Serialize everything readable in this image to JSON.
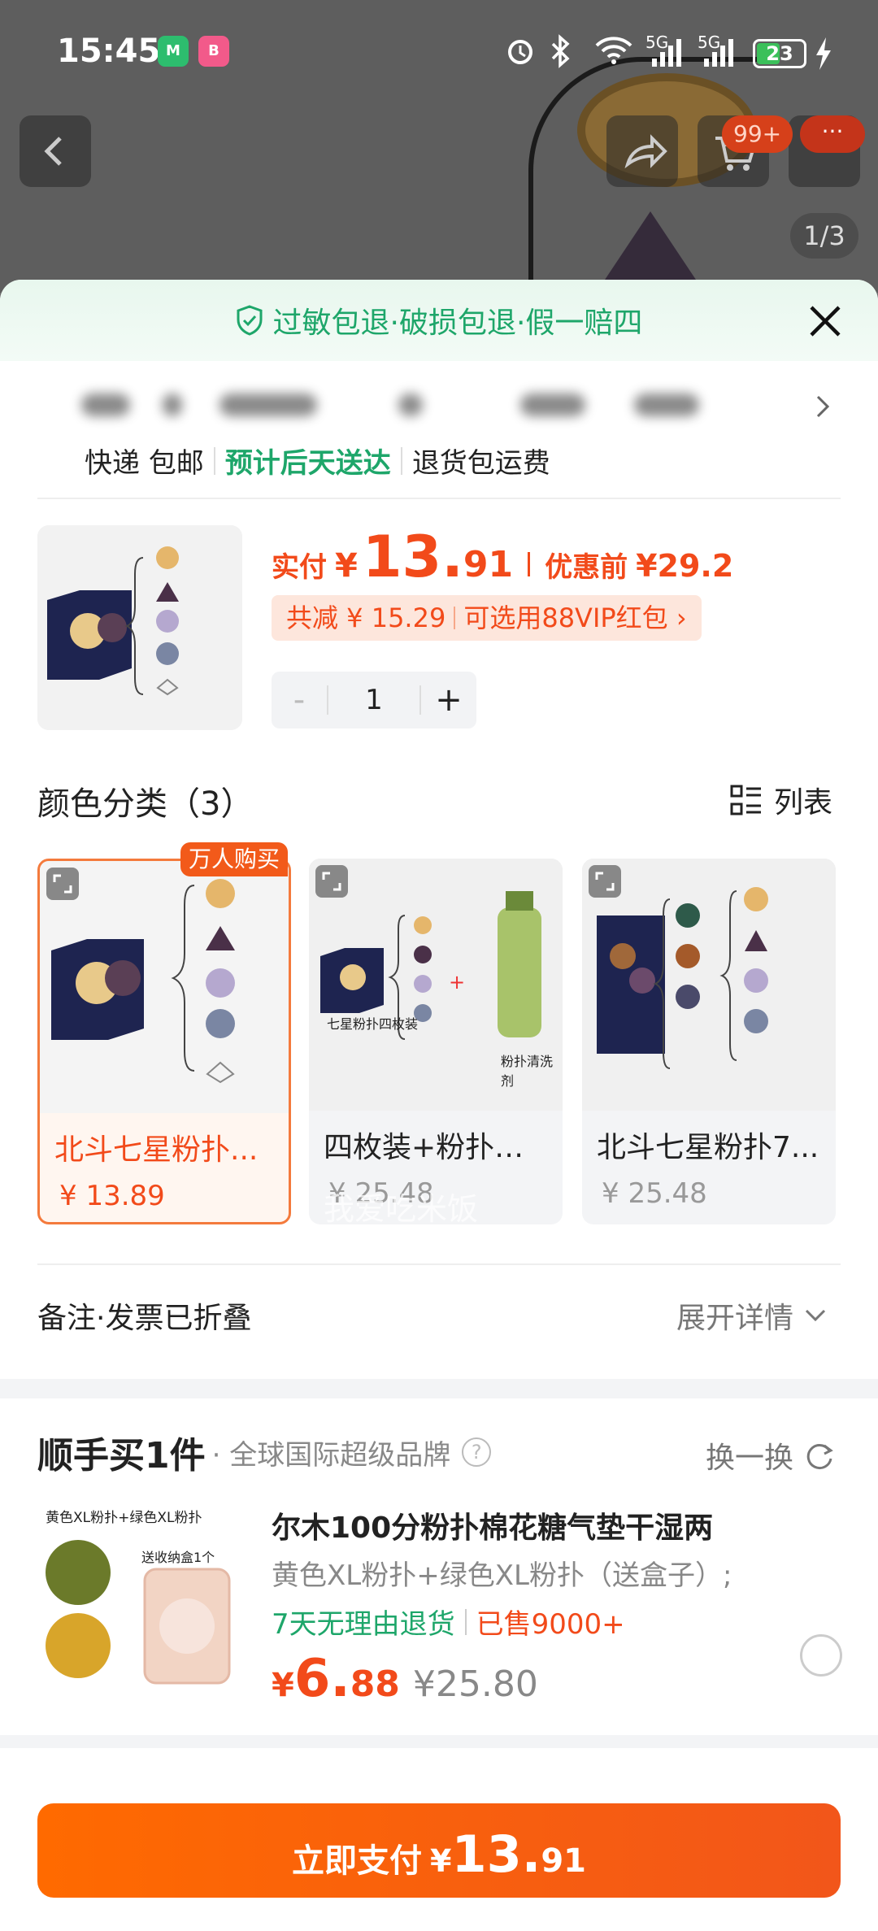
{
  "status_bar": {
    "time": "15:45",
    "battery": "23",
    "signal1": "5G",
    "signal2": "5G"
  },
  "background": {
    "cart_badge": "99+",
    "more_badge": "···",
    "image_pager": "1/3"
  },
  "sheet": {
    "guarantee": "过敏包退·破损包退·假一赔四",
    "shipping": {
      "method": "快递 包邮",
      "eta": "预计后天送达",
      "returns": "退货包运费"
    },
    "price": {
      "paid_label": "实付",
      "currency": "¥",
      "paid_int": "13.",
      "paid_dec": "91",
      "before_label": "优惠前",
      "before_value": "¥29.2"
    },
    "discount": {
      "saved": "共减 ¥ 15.29",
      "vip": "可选用88VIP红包 ›"
    },
    "quantity": {
      "minus": "-",
      "value": "1",
      "plus": "+"
    },
    "variants": {
      "title": "颜色分类（3）",
      "list_view_label": "列表",
      "hot_tag": "万人购买",
      "items": [
        {
          "name": "北斗七星粉扑...",
          "price": "¥ 13.89",
          "selected": true
        },
        {
          "name": "四枚装+粉扑清...",
          "price": "¥ 25.48",
          "selected": false
        },
        {
          "name": "北斗七星粉扑7...",
          "price": "¥ 25.48",
          "selected": false
        }
      ],
      "card2_texts": {
        "left": "七星粉扑四枚装",
        "right": "粉扑清洗剂"
      }
    },
    "watermark": "我爱吃米饭",
    "remark": {
      "label": "备注·发票已折叠",
      "expand": "展开详情"
    },
    "addon": {
      "title": "顺手买1件",
      "subtitle": "· 全球国际超级品牌",
      "help": "?",
      "swap": "换一换",
      "image_caption_top": "黄色XL粉扑+绿色XL粉扑",
      "image_caption_box": "送收纳盒1个",
      "name": "尔木100分粉扑棉花糖气垫干湿两",
      "spec": "黄色XL粉扑+绿色XL粉扑（送盒子）;",
      "return_policy": "7天无理由退货",
      "sold": "已售9000+",
      "price_yen": "¥",
      "price_int": "6.",
      "price_dec": "88",
      "original_price": "¥25.80"
    },
    "pay_button": {
      "label": "立即支付",
      "yen": "¥",
      "amount_int": "13.",
      "amount_dec": "91"
    }
  },
  "colors": {
    "accent_orange": "#f24a1a",
    "green": "#1ea66a"
  }
}
